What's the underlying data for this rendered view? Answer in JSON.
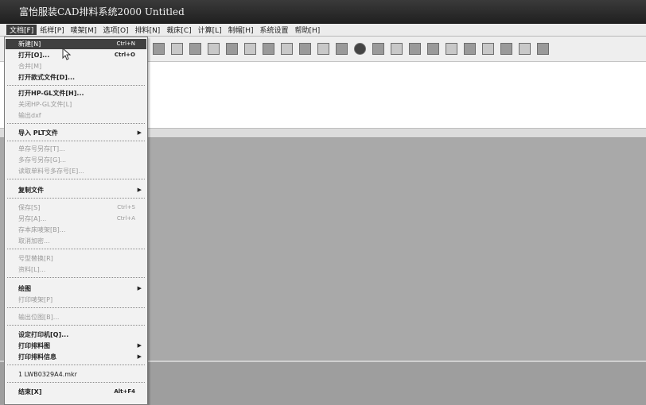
{
  "window": {
    "title": "富怡服装CAD排料系统2000 Untitled"
  },
  "menubar": {
    "items": [
      "文档[F]",
      "纸样[P]",
      "唛架[M]",
      "选项[O]",
      "排料[N]",
      "裁床[C]",
      "计算[L]",
      "制帽[H]",
      "系统设置",
      "帮助[H]"
    ]
  },
  "file_menu": {
    "items": [
      {
        "label": "新建[N]",
        "shortcut": "Ctrl+N",
        "disabled": false,
        "highlighted": true
      },
      {
        "label": "打开[O]...",
        "shortcut": "Ctrl+O",
        "disabled": false
      },
      {
        "label": "合并[M]",
        "shortcut": "",
        "disabled": true
      },
      {
        "label": "打开款式文件[D]...",
        "shortcut": "",
        "disabled": false
      },
      {
        "label": "打开HP-GL文件[H]...",
        "shortcut": "",
        "disabled": false
      },
      {
        "label": "关闭HP-GL文件[L]",
        "shortcut": "",
        "disabled": true
      },
      {
        "label": "输出dxf",
        "shortcut": "",
        "disabled": true
      },
      {
        "label": "导入 PLT文件",
        "shortcut": "",
        "disabled": false,
        "submenu": true
      },
      {
        "label": "单存号另存[T]...",
        "shortcut": "",
        "disabled": true
      },
      {
        "label": "多存号另存[G]...",
        "shortcut": "",
        "disabled": true
      },
      {
        "label": "读取单料号多存号[E]...",
        "shortcut": "",
        "disabled": true
      },
      {
        "label": "复制文件",
        "shortcut": "",
        "disabled": false,
        "submenu": true
      },
      {
        "label": "保存[S]",
        "shortcut": "Ctrl+S",
        "disabled": true
      },
      {
        "label": "另存[A]...",
        "shortcut": "Ctrl+A",
        "disabled": true
      },
      {
        "label": "存本床唛架[B]...",
        "shortcut": "",
        "disabled": true
      },
      {
        "label": "取消加密...",
        "shortcut": "",
        "disabled": true
      },
      {
        "label": "号型替换[R]",
        "shortcut": "",
        "disabled": true
      },
      {
        "label": "资料[L]...",
        "shortcut": "",
        "disabled": true
      },
      {
        "label": "绘图",
        "shortcut": "",
        "disabled": false,
        "submenu": true
      },
      {
        "label": "打印唛架[P]",
        "shortcut": "",
        "disabled": true
      },
      {
        "label": "输出位图[B]...",
        "shortcut": "",
        "disabled": true
      },
      {
        "label": "设定打印机[Q]...",
        "shortcut": "",
        "disabled": false
      },
      {
        "label": "打印排料图",
        "shortcut": "",
        "disabled": false,
        "submenu": true
      },
      {
        "label": "打印排料信息",
        "shortcut": "",
        "disabled": false,
        "submenu": true
      },
      {
        "label": "1 LWB0329A4.mkr",
        "shortcut": "",
        "disabled": false
      },
      {
        "label": "结束[X]",
        "shortcut": "Alt+F4",
        "disabled": false
      }
    ]
  },
  "icons": {
    "toolbar": [
      "new-icon",
      "open-icon",
      "save-icon",
      "cut-icon",
      "copy-icon",
      "paste-icon",
      "print-icon",
      "zoom-icon",
      "rotate-icon",
      "flip-icon",
      "undo-icon",
      "redo-icon",
      "measure-icon",
      "circle-icon",
      "grid-icon",
      "text-icon",
      "select-icon",
      "layer-icon",
      "table-icon",
      "info-icon",
      "triangle-icon",
      "cursor-icon",
      "marker-icon",
      "trash-icon"
    ]
  }
}
